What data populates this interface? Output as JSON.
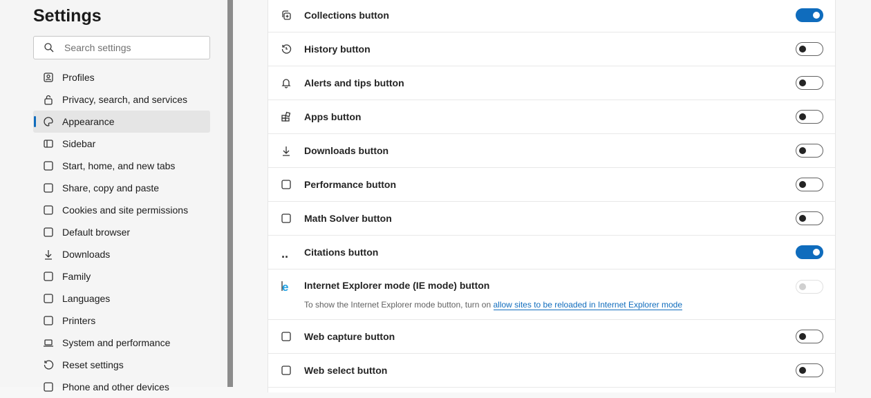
{
  "sidebar": {
    "title": "Settings",
    "search_placeholder": "Search settings",
    "items": [
      {
        "label": "Profiles",
        "icon": "profile-icon"
      },
      {
        "label": "Privacy, search, and services",
        "icon": "lock-icon"
      },
      {
        "label": "Appearance",
        "icon": "palette-icon",
        "active": true
      },
      {
        "label": "Sidebar",
        "icon": "sidebar-icon"
      },
      {
        "label": "Start, home, and new tabs",
        "icon": "home-tabs-icon"
      },
      {
        "label": "Share, copy and paste",
        "icon": "share-icon"
      },
      {
        "label": "Cookies and site permissions",
        "icon": "cookies-icon"
      },
      {
        "label": "Default browser",
        "icon": "default-browser-icon"
      },
      {
        "label": "Downloads",
        "icon": "download-icon"
      },
      {
        "label": "Family",
        "icon": "family-icon"
      },
      {
        "label": "Languages",
        "icon": "languages-icon"
      },
      {
        "label": "Printers",
        "icon": "printer-icon"
      },
      {
        "label": "System and performance",
        "icon": "laptop-icon"
      },
      {
        "label": "Reset settings",
        "icon": "reset-icon"
      },
      {
        "label": "Phone and other devices",
        "icon": "phone-icon"
      }
    ]
  },
  "main": {
    "rows": [
      {
        "label": "Collections button",
        "icon": "collections-icon",
        "state": "on"
      },
      {
        "label": "History button",
        "icon": "history-icon",
        "state": "off"
      },
      {
        "label": "Alerts and tips button",
        "icon": "bell-icon",
        "state": "off"
      },
      {
        "label": "Apps button",
        "icon": "apps-icon",
        "state": "off"
      },
      {
        "label": "Downloads button",
        "icon": "download-icon",
        "state": "off"
      },
      {
        "label": "Performance button",
        "icon": "heartbeat-icon",
        "state": "off"
      },
      {
        "label": "Math Solver button",
        "icon": "math-solver-icon",
        "state": "off"
      },
      {
        "label": "Citations button",
        "icon": "quote-icon",
        "state": "on"
      },
      {
        "label": "Internet Explorer mode (IE mode) button",
        "icon": "ie-icon",
        "state": "disabled",
        "note": "To show the Internet Explorer mode button, turn on ",
        "link": "allow sites to be reloaded in Internet Explorer mode"
      },
      {
        "label": "Web capture button",
        "icon": "web-capture-icon",
        "state": "off"
      },
      {
        "label": "Web select button",
        "icon": "web-select-icon",
        "state": "off"
      }
    ]
  },
  "colors": {
    "accent": "#0f6cbd"
  }
}
